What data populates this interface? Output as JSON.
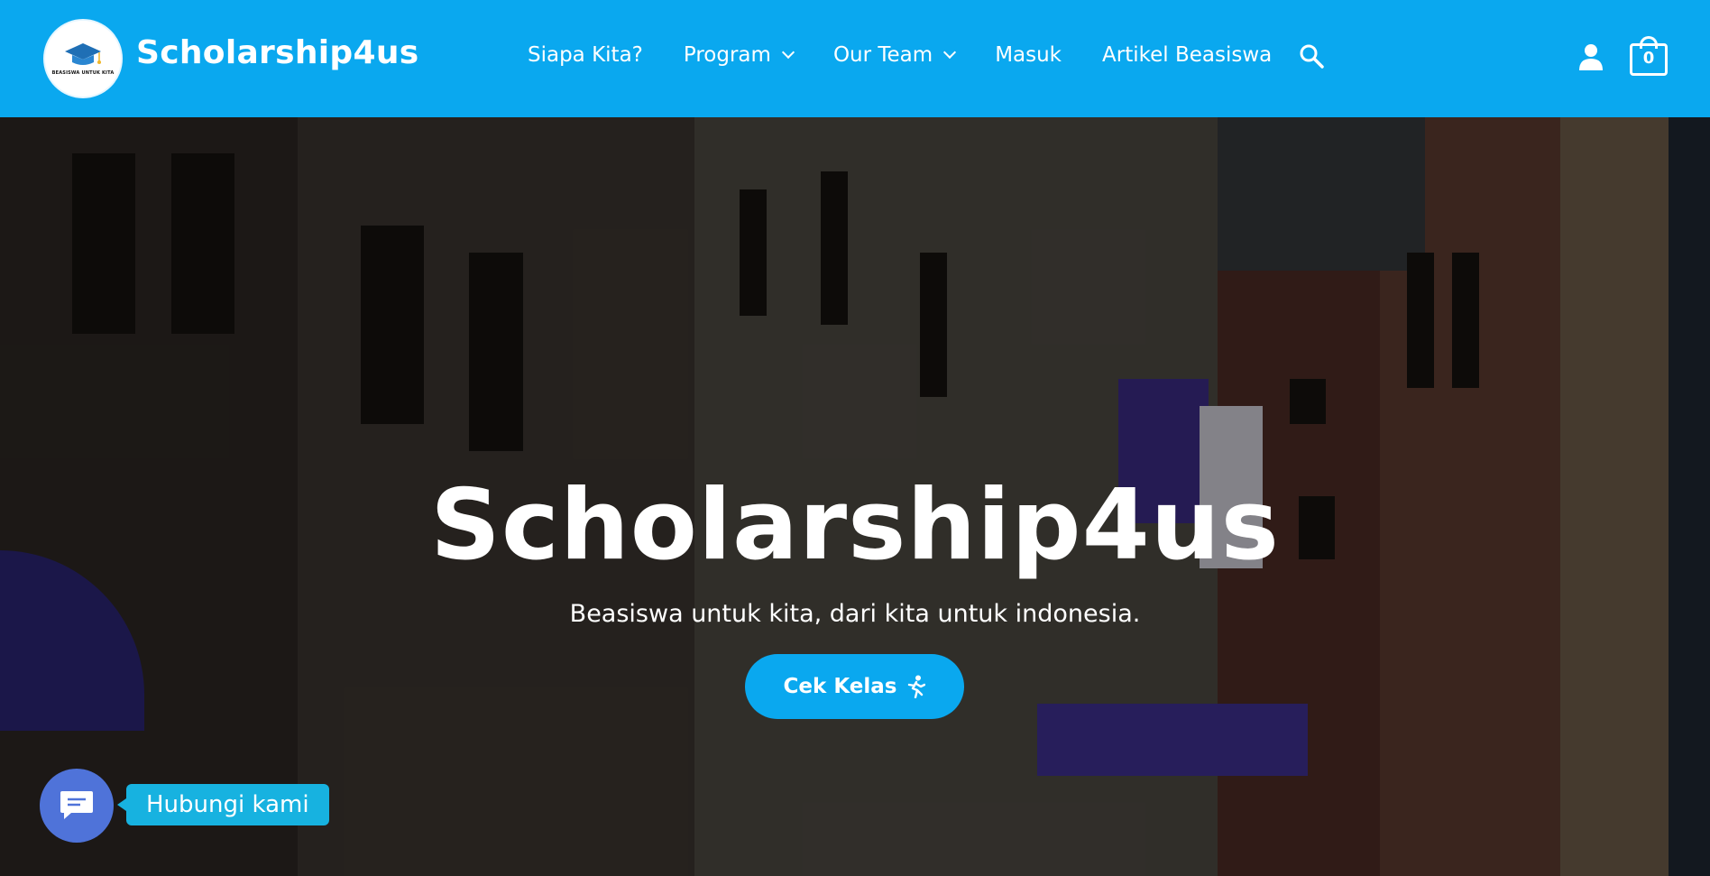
{
  "brand": {
    "name": "Scholarship4us",
    "logo_text": "BEASISWA UNTUK KITA",
    "logo_icon": "graduation-cap-icon"
  },
  "nav": {
    "items": [
      {
        "label": "Siapa Kita?",
        "has_dropdown": false
      },
      {
        "label": "Program",
        "has_dropdown": true
      },
      {
        "label": "Our Team",
        "has_dropdown": true
      },
      {
        "label": "Masuk",
        "has_dropdown": false
      },
      {
        "label": "Artikel Beasiswa",
        "has_dropdown": false
      }
    ],
    "search_icon": "search-icon",
    "account_icon": "user-icon",
    "cart_count": "0"
  },
  "hero": {
    "title": "Scholarship4us",
    "subtitle": "Beasiswa untuk kita, dari kita untuk indonesia.",
    "cta_label": "Cek Kelas",
    "cta_icon": "running-person-icon"
  },
  "chat": {
    "label": "Hubungi kami",
    "icon": "chat-bubble-icon"
  },
  "colors": {
    "header_bg": "#0aa8ef",
    "cta_bg": "#0aa8ef",
    "chat_button_bg": "#4f73d9",
    "chat_label_bg": "#17b2e0"
  }
}
